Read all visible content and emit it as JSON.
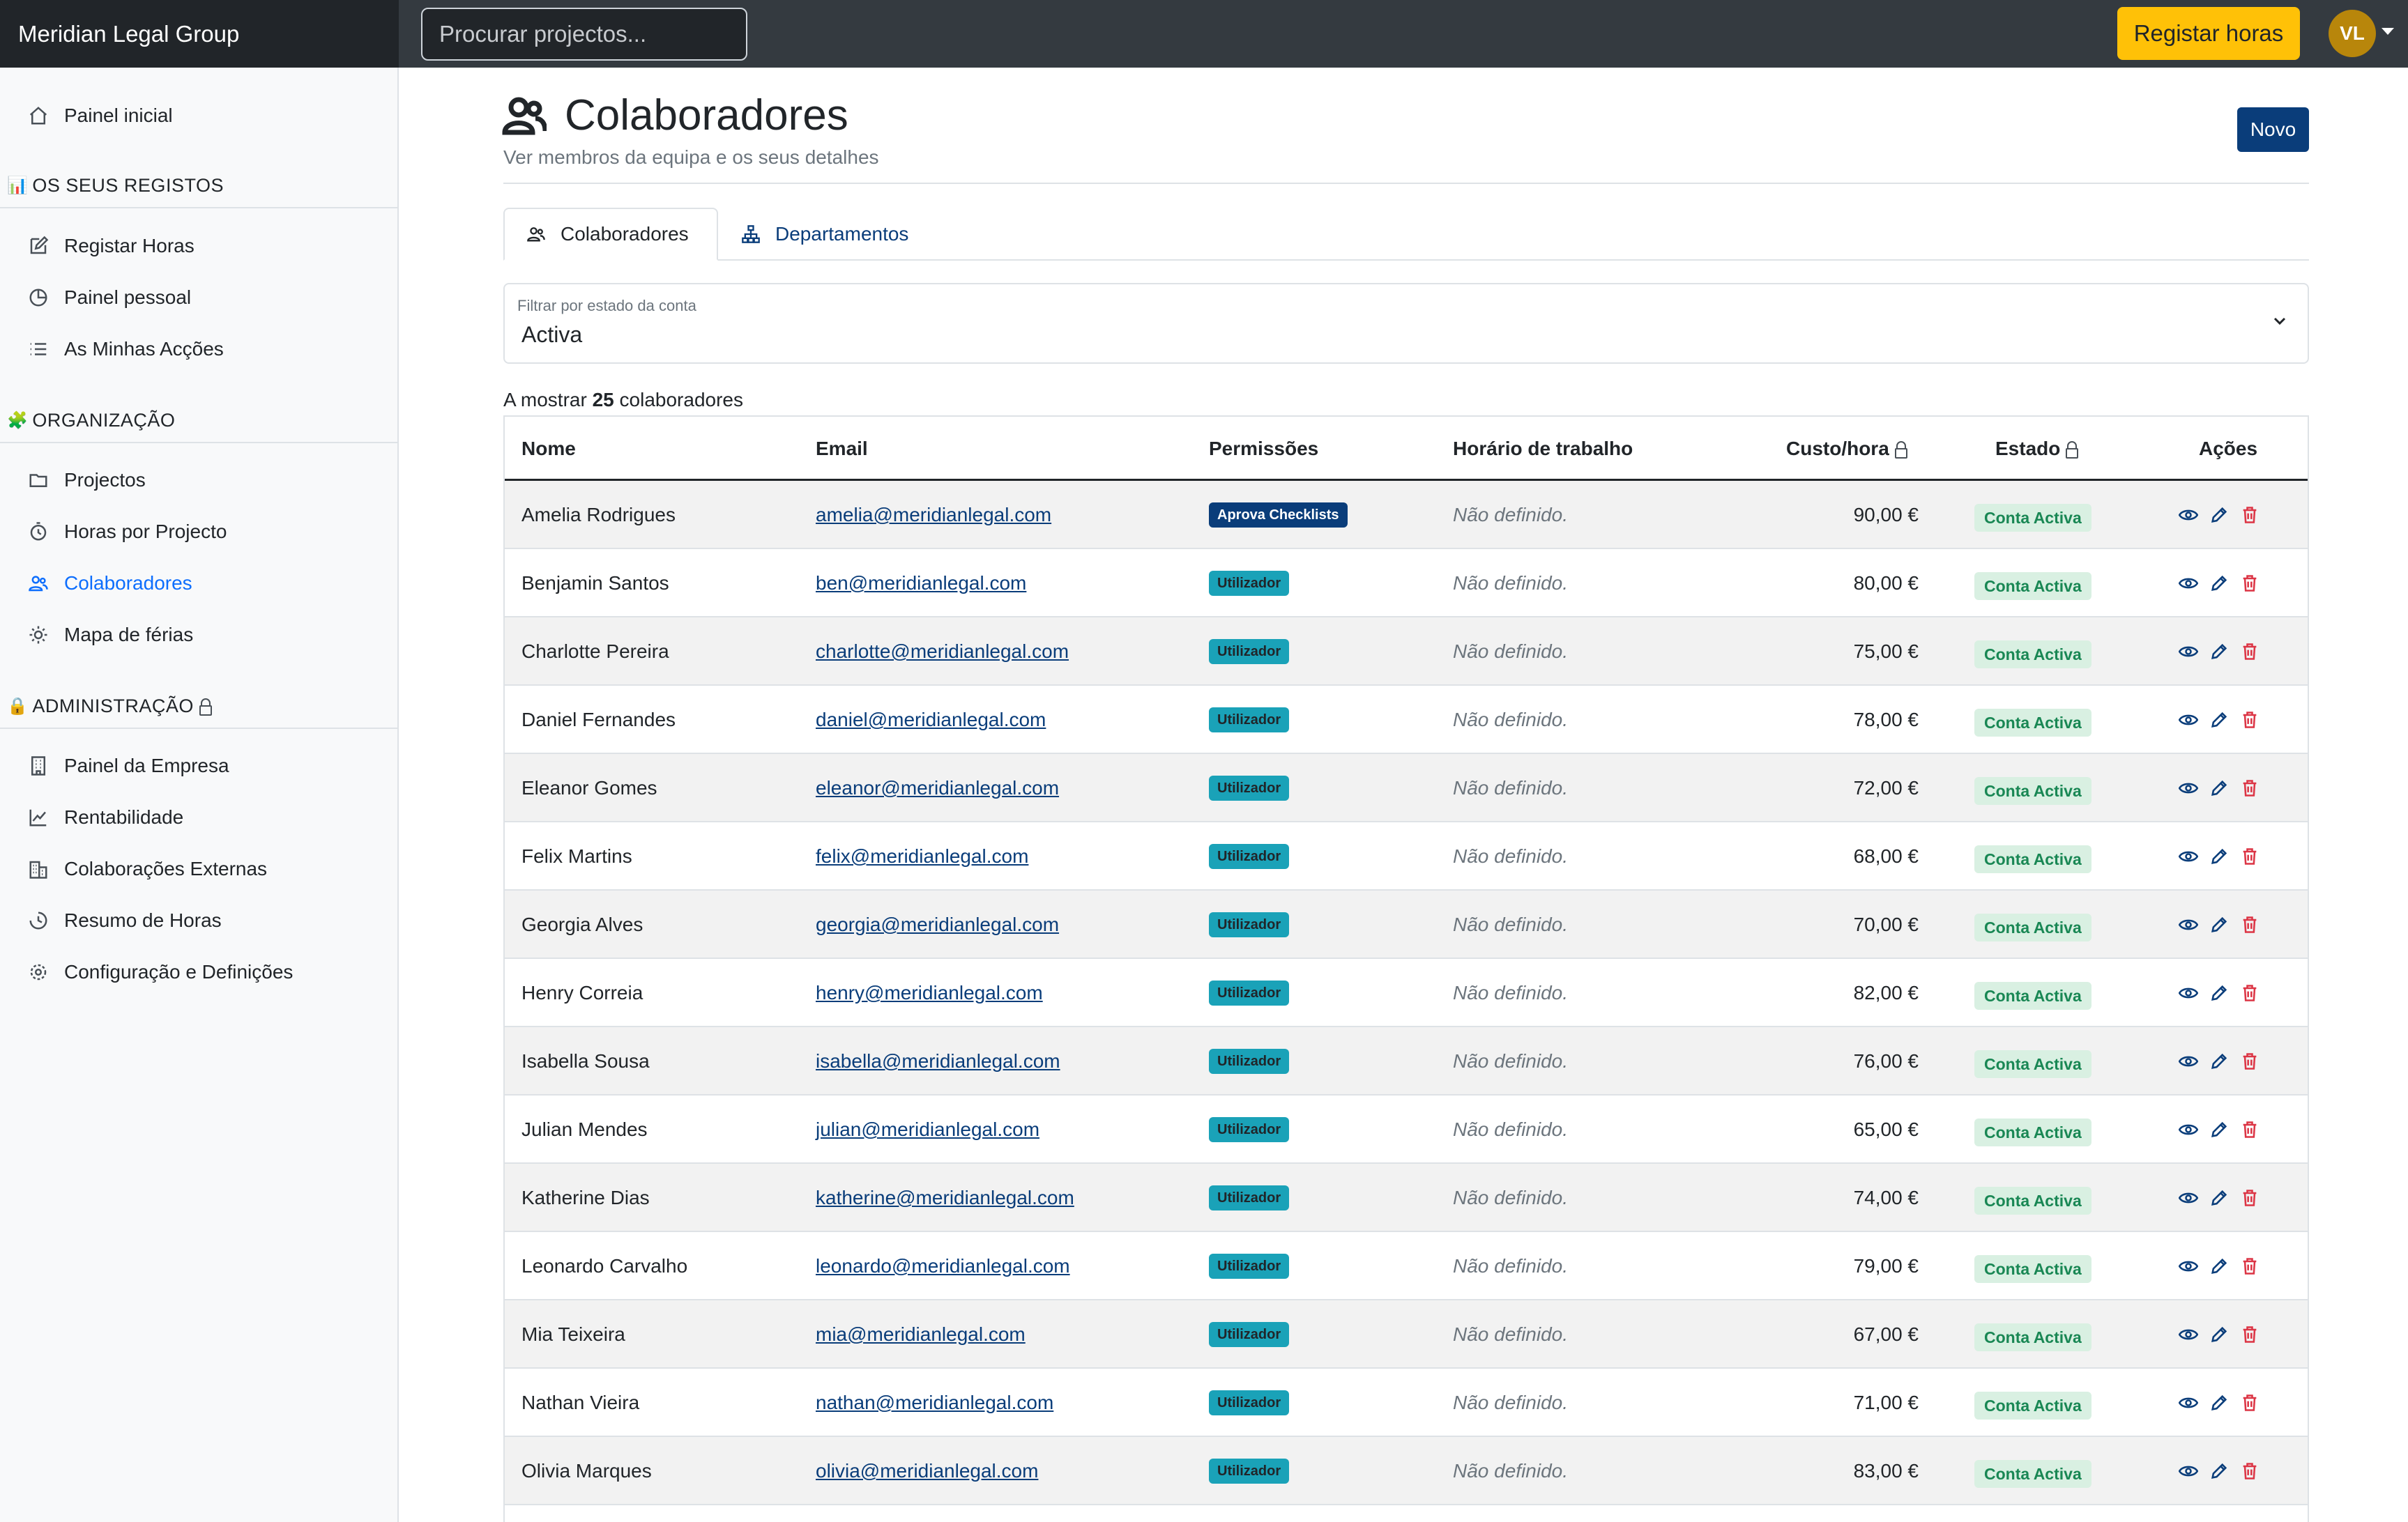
{
  "app": {
    "brand": "Meridian Legal Group",
    "search_placeholder": "Procurar projectos...",
    "register_button": "Registar horas",
    "avatar_initials": "VL"
  },
  "sidebar": {
    "home": "Painel inicial",
    "sections": [
      {
        "title": "OS SEUS REGISTOS",
        "icon": "bar-chart-emoji"
      },
      {
        "title": "ORGANIZAÇÃO",
        "icon": "puzzle-emoji"
      },
      {
        "title": "ADMINISTRAÇÃO",
        "icon": "lock-emoji"
      }
    ],
    "records_items": [
      "Registar Horas",
      "Painel pessoal",
      "As Minhas Acções"
    ],
    "org_items": [
      "Projectos",
      "Horas por Projecto",
      "Colaboradores",
      "Mapa de férias"
    ],
    "admin_items": [
      "Painel da Empresa",
      "Rentabilidade",
      "Colaborações Externas",
      "Resumo de Horas",
      "Configuração e Definições"
    ],
    "active_item": "Colaboradores"
  },
  "page": {
    "title": "Colaboradores",
    "subtitle": "Ver membros da equipa e os seus detalhes",
    "new_button": "Novo",
    "tabs": [
      "Colaboradores",
      "Departamentos"
    ],
    "filter_label": "Filtrar por estado da conta",
    "filter_value": "Activa",
    "count_prefix": "A mostrar",
    "count_value": "25",
    "count_suffix": "colaboradores"
  },
  "table": {
    "headers": [
      "Nome",
      "Email",
      "Permissões",
      "Horário de trabalho",
      "Custo/hora",
      "Estado",
      "Ações"
    ],
    "rows": [
      {
        "name": "Amelia Rodrigues",
        "email": "amelia@meridianlegal.com",
        "perm": "Aprova Checklists",
        "sched": "Não definido.",
        "cost": "90,00 €",
        "state": "Conta Activa"
      },
      {
        "name": "Benjamin Santos",
        "email": "ben@meridianlegal.com",
        "perm": "Utilizador",
        "sched": "Não definido.",
        "cost": "80,00 €",
        "state": "Conta Activa"
      },
      {
        "name": "Charlotte Pereira",
        "email": "charlotte@meridianlegal.com",
        "perm": "Utilizador",
        "sched": "Não definido.",
        "cost": "75,00 €",
        "state": "Conta Activa"
      },
      {
        "name": "Daniel Fernandes",
        "email": "daniel@meridianlegal.com",
        "perm": "Utilizador",
        "sched": "Não definido.",
        "cost": "78,00 €",
        "state": "Conta Activa"
      },
      {
        "name": "Eleanor Gomes",
        "email": "eleanor@meridianlegal.com",
        "perm": "Utilizador",
        "sched": "Não definido.",
        "cost": "72,00 €",
        "state": "Conta Activa"
      },
      {
        "name": "Felix Martins",
        "email": "felix@meridianlegal.com",
        "perm": "Utilizador",
        "sched": "Não definido.",
        "cost": "68,00 €",
        "state": "Conta Activa"
      },
      {
        "name": "Georgia Alves",
        "email": "georgia@meridianlegal.com",
        "perm": "Utilizador",
        "sched": "Não definido.",
        "cost": "70,00 €",
        "state": "Conta Activa"
      },
      {
        "name": "Henry Correia",
        "email": "henry@meridianlegal.com",
        "perm": "Utilizador",
        "sched": "Não definido.",
        "cost": "82,00 €",
        "state": "Conta Activa"
      },
      {
        "name": "Isabella Sousa",
        "email": "isabella@meridianlegal.com",
        "perm": "Utilizador",
        "sched": "Não definido.",
        "cost": "76,00 €",
        "state": "Conta Activa"
      },
      {
        "name": "Julian Mendes",
        "email": "julian@meridianlegal.com",
        "perm": "Utilizador",
        "sched": "Não definido.",
        "cost": "65,00 €",
        "state": "Conta Activa"
      },
      {
        "name": "Katherine Dias",
        "email": "katherine@meridianlegal.com",
        "perm": "Utilizador",
        "sched": "Não definido.",
        "cost": "74,00 €",
        "state": "Conta Activa"
      },
      {
        "name": "Leonardo Carvalho",
        "email": "leonardo@meridianlegal.com",
        "perm": "Utilizador",
        "sched": "Não definido.",
        "cost": "79,00 €",
        "state": "Conta Activa"
      },
      {
        "name": "Mia Teixeira",
        "email": "mia@meridianlegal.com",
        "perm": "Utilizador",
        "sched": "Não definido.",
        "cost": "67,00 €",
        "state": "Conta Activa"
      },
      {
        "name": "Nathan Vieira",
        "email": "nathan@meridianlegal.com",
        "perm": "Utilizador",
        "sched": "Não definido.",
        "cost": "71,00 €",
        "state": "Conta Activa"
      },
      {
        "name": "Olivia Marques",
        "email": "olivia@meridianlegal.com",
        "perm": "Utilizador",
        "sched": "Não definido.",
        "cost": "83,00 €",
        "state": "Conta Activa"
      }
    ]
  },
  "colors": {
    "topbar": "#343a40",
    "brand_bg": "#212529",
    "accent_yellow": "#ffc107",
    "primary_navy": "#0a3d7a",
    "active_link": "#0d6efd",
    "info_badge": "#1aa2b8",
    "success_text": "#198754",
    "danger": "#dc3545"
  }
}
